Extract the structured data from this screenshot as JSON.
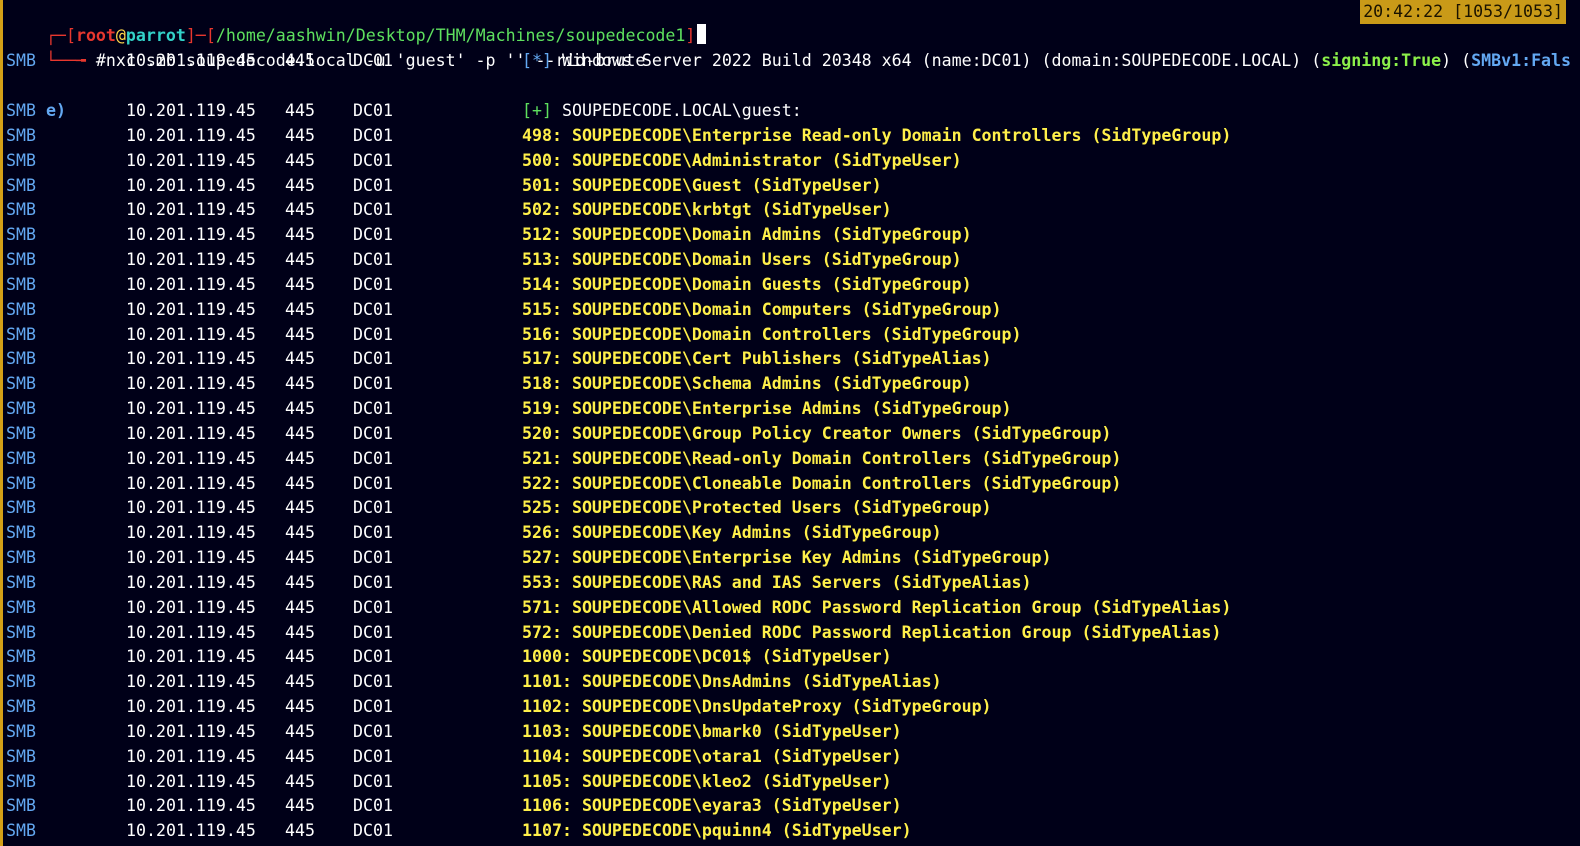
{
  "prompt": {
    "user": "root",
    "at": "@",
    "host": "parrot",
    "path": "/home/aashwin/Desktop/THM/Machines/soupedecode1",
    "command": "#nxc smb soupedecode.local -u 'guest' -p '' --rid-brute",
    "clock": "20:42:22 [1053/1053]"
  },
  "colors": {
    "background": "#000018",
    "prompt_red": "#e8372e",
    "path_cyan": "#32d2c8",
    "result_yellow": "#fff04a",
    "proto_blue": "#63a8f2",
    "clock_bg": "#c99a18"
  },
  "first": {
    "proto": "SMB",
    "ip": "10.201.119.45",
    "port": "445",
    "host": "DC01",
    "marker": "[*]",
    "text_a": " Windows Server 2022 Build 20348 x64 (name:DC01) (domain:SOUPEDECODE.LOCAL) (",
    "signing": "signing:True",
    "text_b": ") (",
    "smbv1": "SMBv1:Fals",
    "wrap": "e)"
  },
  "second": {
    "proto": "SMB",
    "ip": "10.201.119.45",
    "port": "445",
    "host": "DC01",
    "marker": "[+]",
    "text": " SOUPEDECODE.LOCAL\\guest:"
  },
  "rows": [
    {
      "proto": "SMB",
      "ip": "10.201.119.45",
      "port": "445",
      "host": "DC01",
      "msg": "498: SOUPEDECODE\\Enterprise Read-only Domain Controllers (SidTypeGroup)"
    },
    {
      "proto": "SMB",
      "ip": "10.201.119.45",
      "port": "445",
      "host": "DC01",
      "msg": "500: SOUPEDECODE\\Administrator (SidTypeUser)"
    },
    {
      "proto": "SMB",
      "ip": "10.201.119.45",
      "port": "445",
      "host": "DC01",
      "msg": "501: SOUPEDECODE\\Guest (SidTypeUser)"
    },
    {
      "proto": "SMB",
      "ip": "10.201.119.45",
      "port": "445",
      "host": "DC01",
      "msg": "502: SOUPEDECODE\\krbtgt (SidTypeUser)"
    },
    {
      "proto": "SMB",
      "ip": "10.201.119.45",
      "port": "445",
      "host": "DC01",
      "msg": "512: SOUPEDECODE\\Domain Admins (SidTypeGroup)"
    },
    {
      "proto": "SMB",
      "ip": "10.201.119.45",
      "port": "445",
      "host": "DC01",
      "msg": "513: SOUPEDECODE\\Domain Users (SidTypeGroup)"
    },
    {
      "proto": "SMB",
      "ip": "10.201.119.45",
      "port": "445",
      "host": "DC01",
      "msg": "514: SOUPEDECODE\\Domain Guests (SidTypeGroup)"
    },
    {
      "proto": "SMB",
      "ip": "10.201.119.45",
      "port": "445",
      "host": "DC01",
      "msg": "515: SOUPEDECODE\\Domain Computers (SidTypeGroup)"
    },
    {
      "proto": "SMB",
      "ip": "10.201.119.45",
      "port": "445",
      "host": "DC01",
      "msg": "516: SOUPEDECODE\\Domain Controllers (SidTypeGroup)"
    },
    {
      "proto": "SMB",
      "ip": "10.201.119.45",
      "port": "445",
      "host": "DC01",
      "msg": "517: SOUPEDECODE\\Cert Publishers (SidTypeAlias)"
    },
    {
      "proto": "SMB",
      "ip": "10.201.119.45",
      "port": "445",
      "host": "DC01",
      "msg": "518: SOUPEDECODE\\Schema Admins (SidTypeGroup)"
    },
    {
      "proto": "SMB",
      "ip": "10.201.119.45",
      "port": "445",
      "host": "DC01",
      "msg": "519: SOUPEDECODE\\Enterprise Admins (SidTypeGroup)"
    },
    {
      "proto": "SMB",
      "ip": "10.201.119.45",
      "port": "445",
      "host": "DC01",
      "msg": "520: SOUPEDECODE\\Group Policy Creator Owners (SidTypeGroup)"
    },
    {
      "proto": "SMB",
      "ip": "10.201.119.45",
      "port": "445",
      "host": "DC01",
      "msg": "521: SOUPEDECODE\\Read-only Domain Controllers (SidTypeGroup)"
    },
    {
      "proto": "SMB",
      "ip": "10.201.119.45",
      "port": "445",
      "host": "DC01",
      "msg": "522: SOUPEDECODE\\Cloneable Domain Controllers (SidTypeGroup)"
    },
    {
      "proto": "SMB",
      "ip": "10.201.119.45",
      "port": "445",
      "host": "DC01",
      "msg": "525: SOUPEDECODE\\Protected Users (SidTypeGroup)"
    },
    {
      "proto": "SMB",
      "ip": "10.201.119.45",
      "port": "445",
      "host": "DC01",
      "msg": "526: SOUPEDECODE\\Key Admins (SidTypeGroup)"
    },
    {
      "proto": "SMB",
      "ip": "10.201.119.45",
      "port": "445",
      "host": "DC01",
      "msg": "527: SOUPEDECODE\\Enterprise Key Admins (SidTypeGroup)"
    },
    {
      "proto": "SMB",
      "ip": "10.201.119.45",
      "port": "445",
      "host": "DC01",
      "msg": "553: SOUPEDECODE\\RAS and IAS Servers (SidTypeAlias)"
    },
    {
      "proto": "SMB",
      "ip": "10.201.119.45",
      "port": "445",
      "host": "DC01",
      "msg": "571: SOUPEDECODE\\Allowed RODC Password Replication Group (SidTypeAlias)"
    },
    {
      "proto": "SMB",
      "ip": "10.201.119.45",
      "port": "445",
      "host": "DC01",
      "msg": "572: SOUPEDECODE\\Denied RODC Password Replication Group (SidTypeAlias)"
    },
    {
      "proto": "SMB",
      "ip": "10.201.119.45",
      "port": "445",
      "host": "DC01",
      "msg": "1000: SOUPEDECODE\\DC01$ (SidTypeUser)"
    },
    {
      "proto": "SMB",
      "ip": "10.201.119.45",
      "port": "445",
      "host": "DC01",
      "msg": "1101: SOUPEDECODE\\DnsAdmins (SidTypeAlias)"
    },
    {
      "proto": "SMB",
      "ip": "10.201.119.45",
      "port": "445",
      "host": "DC01",
      "msg": "1102: SOUPEDECODE\\DnsUpdateProxy (SidTypeGroup)"
    },
    {
      "proto": "SMB",
      "ip": "10.201.119.45",
      "port": "445",
      "host": "DC01",
      "msg": "1103: SOUPEDECODE\\bmark0 (SidTypeUser)"
    },
    {
      "proto": "SMB",
      "ip": "10.201.119.45",
      "port": "445",
      "host": "DC01",
      "msg": "1104: SOUPEDECODE\\otara1 (SidTypeUser)"
    },
    {
      "proto": "SMB",
      "ip": "10.201.119.45",
      "port": "445",
      "host": "DC01",
      "msg": "1105: SOUPEDECODE\\kleo2 (SidTypeUser)"
    },
    {
      "proto": "SMB",
      "ip": "10.201.119.45",
      "port": "445",
      "host": "DC01",
      "msg": "1106: SOUPEDECODE\\eyara3 (SidTypeUser)"
    },
    {
      "proto": "SMB",
      "ip": "10.201.119.45",
      "port": "445",
      "host": "DC01",
      "msg": "1107: SOUPEDECODE\\pquinn4 (SidTypeUser)"
    }
  ]
}
